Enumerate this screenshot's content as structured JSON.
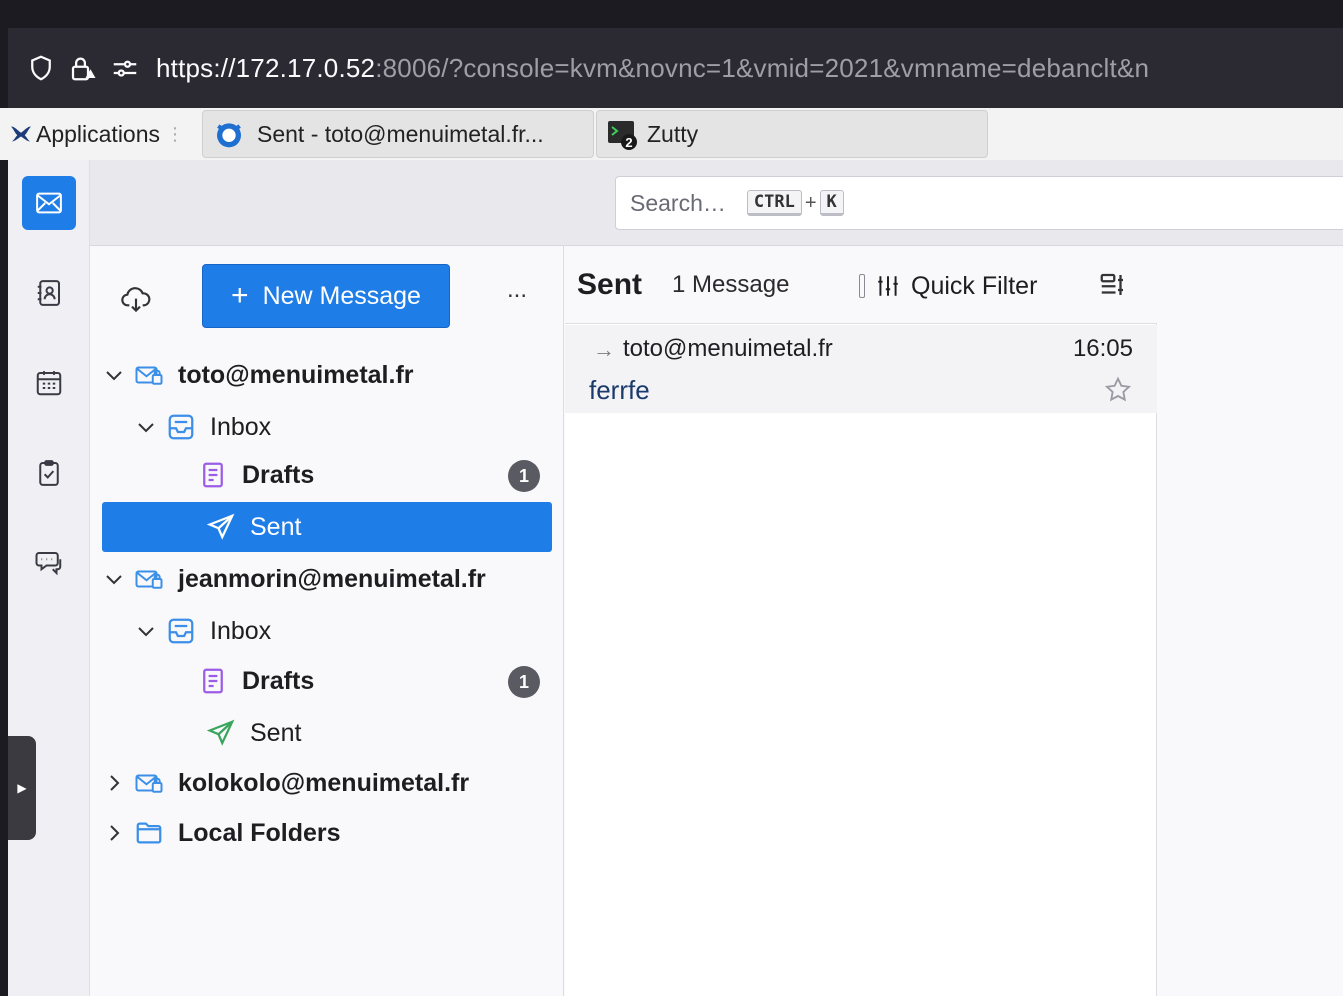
{
  "browser": {
    "url_main": "https://172.17.0.52",
    "url_rest": ":8006/?console=kvm&novnc=1&vmid=2021&vmname=debanclt&n"
  },
  "taskbar": {
    "applications_label": "Applications",
    "windows": [
      {
        "label": "Sent - toto@menuimetal.fr..."
      },
      {
        "label": "Zutty",
        "badge": "2"
      }
    ]
  },
  "search": {
    "placeholder": "Search…",
    "shortcut_key1": "CTRL",
    "shortcut_plus": "+",
    "shortcut_key2": "K"
  },
  "toolbar": {
    "new_message_label": "New Message",
    "more_label": "..."
  },
  "folders": {
    "accounts": [
      {
        "name": "toto@menuimetal.fr",
        "inbox": "Inbox",
        "drafts": "Drafts",
        "drafts_count": "1",
        "sent": "Sent"
      },
      {
        "name": "jeanmorin@menuimetal.fr",
        "inbox": "Inbox",
        "drafts": "Drafts",
        "drafts_count": "1",
        "sent": "Sent"
      },
      {
        "name": "kolokolo@menuimetal.fr"
      }
    ],
    "local_folders": "Local Folders"
  },
  "thread": {
    "folder_name": "Sent",
    "message_count": "1 Message",
    "quick_filter_label": "Quick Filter",
    "messages": [
      {
        "arrow": "→",
        "recipient": "toto@menuimetal.fr",
        "time": "16:05",
        "subject": "ferrfe"
      }
    ]
  },
  "colors": {
    "accent": "#1f7de8",
    "drafts_icon": "#9b5de5",
    "sent_icon": "#3aa55c",
    "account_icon": "#3c8fe8"
  }
}
